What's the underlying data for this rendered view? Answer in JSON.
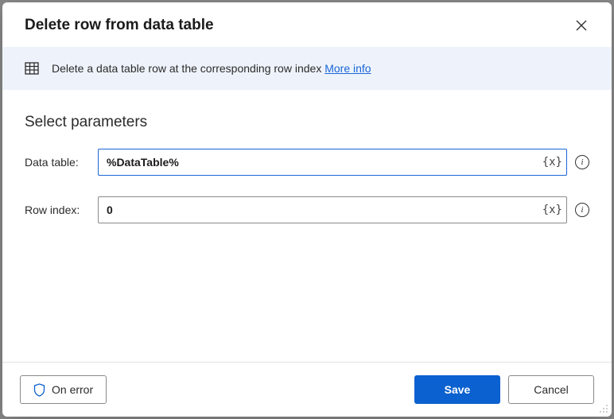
{
  "dialog": {
    "title": "Delete row from data table",
    "info_text": "Delete a data table row at the corresponding row index ",
    "more_info": "More info"
  },
  "params": {
    "section_title": "Select parameters",
    "rows": [
      {
        "label": "Data table:",
        "value": "%DataTable%",
        "focused": true
      },
      {
        "label": "Row index:",
        "value": "0",
        "focused": false
      }
    ],
    "var_token": "{x}"
  },
  "footer": {
    "on_error": "On error",
    "save": "Save",
    "cancel": "Cancel"
  }
}
